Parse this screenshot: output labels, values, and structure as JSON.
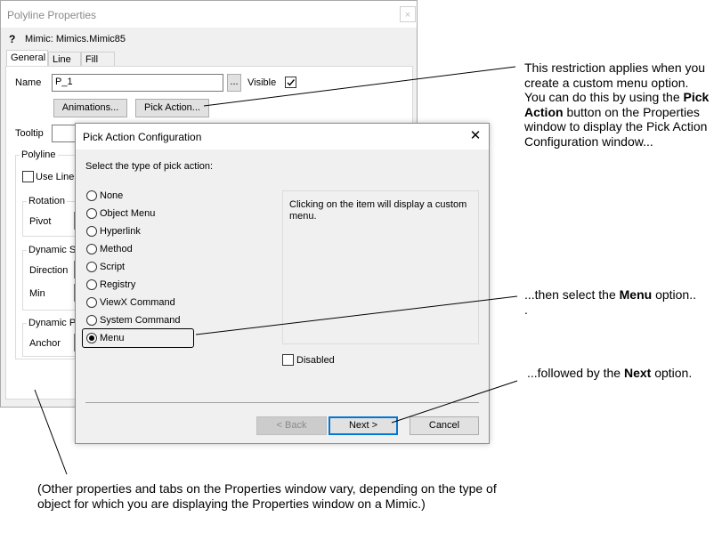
{
  "props_window": {
    "title": "Polyline Properties",
    "close": "×",
    "help_icon": "?",
    "mimic_label": "Mimic: Mimics.Mimic85",
    "tabs": [
      "General",
      "Line",
      "Fill"
    ],
    "name_label": "Name",
    "name_value": "P_1",
    "browse_label": "...",
    "visible_label": "Visible",
    "visible_checked": true,
    "animations_button": "Animations...",
    "pick_action_button": "Pick Action...",
    "tooltip_label": "Tooltip",
    "polyline_group": "Polyline",
    "use_line_label": "Use Line",
    "rotation_group": "Rotation",
    "pivot_label": "Pivot",
    "dynamic_size_group": "Dynamic Si",
    "direction_label": "Direction",
    "min_label": "Min",
    "dynamic_pos_group": "Dynamic Po",
    "anchor_label": "Anchor"
  },
  "dialog": {
    "title": "Pick Action Configuration",
    "close": "✕",
    "prompt": "Select the type of pick action:",
    "options": [
      "None",
      "Object Menu",
      "Hyperlink",
      "Method",
      "Script",
      "Registry",
      "ViewX Command",
      "System Command",
      "Menu"
    ],
    "selected_index": 8,
    "description": "Clicking on the item will display a custom menu.",
    "disabled_label": "Disabled",
    "back_button": "< Back",
    "next_button": "Next >",
    "cancel_button": "Cancel"
  },
  "callouts": {
    "pick_action_p1": "This restriction applies when you create a custom menu option. You can do this by using the ",
    "pick_action_bold": "Pick Action",
    "pick_action_p2": " button on the Properties window to display the Pick Action Configuration window...",
    "menu_p1": "...then select the ",
    "menu_bold": "Menu",
    "menu_p2": " option..",
    "menu_p3": ".",
    "next_p1": "...followed by the ",
    "next_bold": "Next",
    "next_p2": " option.",
    "other_props": "(Other properties and tabs on the Properties window vary, depending on the type of object for which you are displaying the Properties window on a Mimic.)"
  }
}
